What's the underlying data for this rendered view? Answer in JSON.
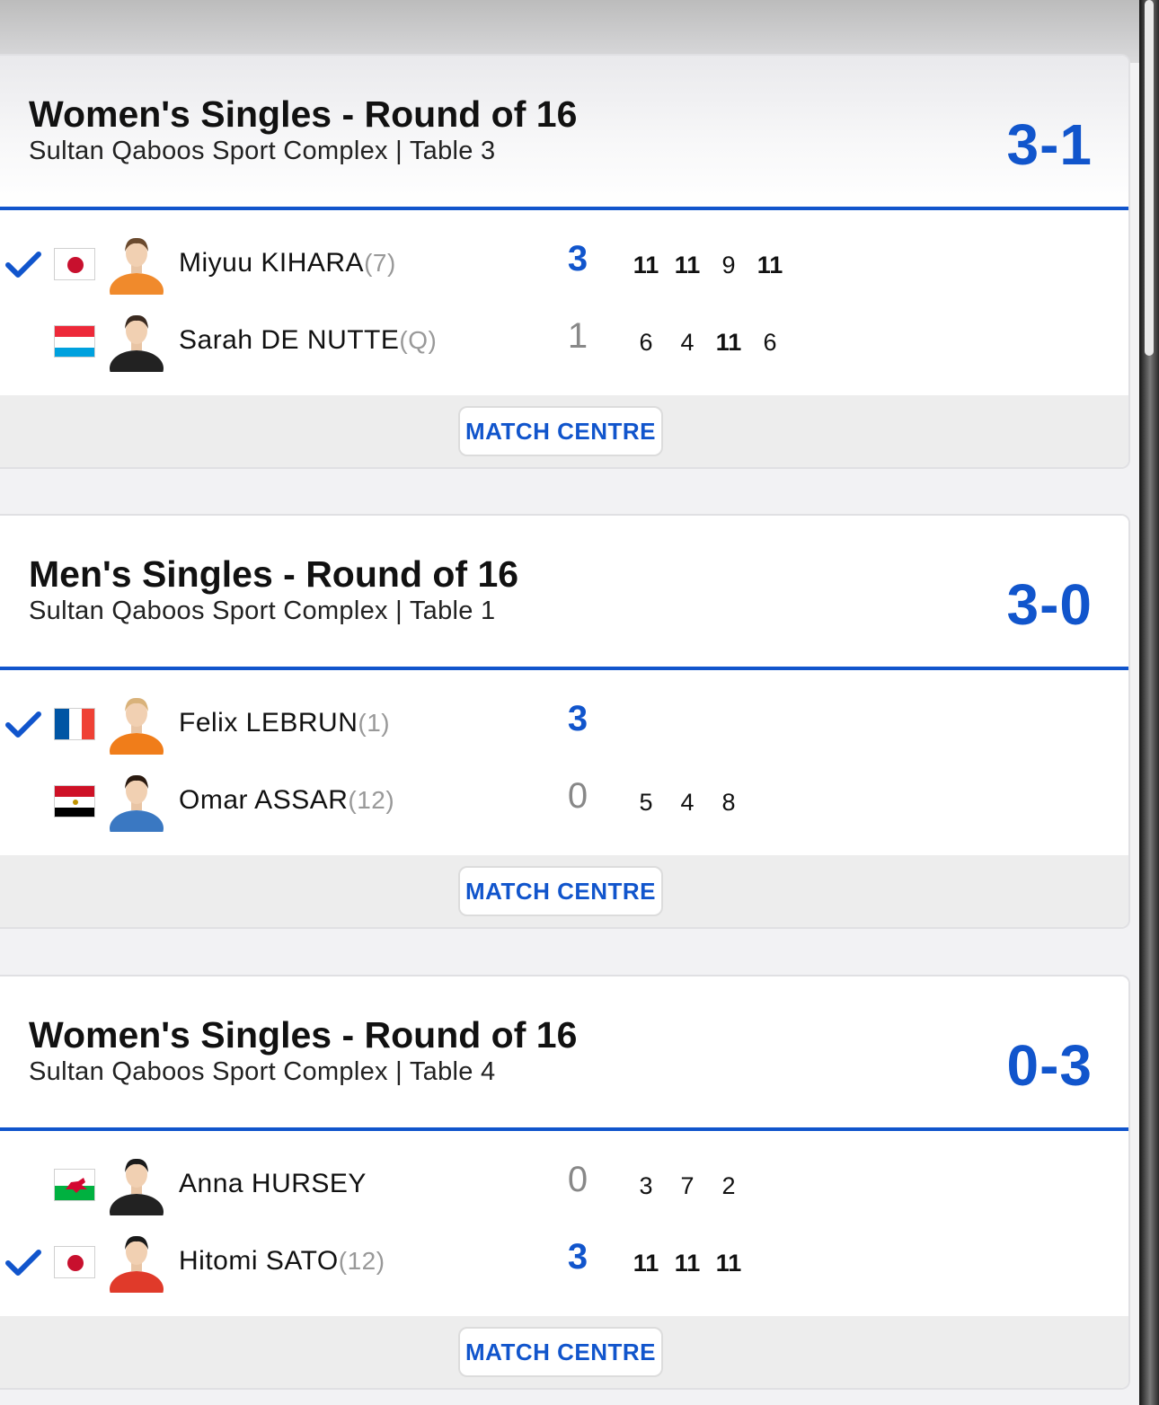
{
  "matches": [
    {
      "event": "Women's Singles - Round of 16",
      "venue": "Sultan Qaboos Sport Complex | Table 3",
      "score": "3-1",
      "players": [
        {
          "name": "Miyuu KIHARA",
          "seed": "(7)",
          "flag": "japan-flag",
          "games": "3",
          "sets": [
            "11",
            "11",
            "9",
            "11"
          ],
          "winner": true
        },
        {
          "name": "Sarah DE NUTTE",
          "seed": "(Q)",
          "flag": "luxembourg-flag",
          "games": "1",
          "sets": [
            "6",
            "4",
            "11",
            "6"
          ],
          "winner": false
        }
      ],
      "button": "MATCH CENTRE"
    },
    {
      "event": "Men's Singles - Round of 16",
      "venue": "Sultan Qaboos Sport Complex | Table 1",
      "score": "3-0",
      "players": [
        {
          "name": "Felix LEBRUN",
          "seed": "(1)",
          "flag": "france-flag",
          "games": "3",
          "sets": [],
          "winner": true
        },
        {
          "name": "Omar ASSAR",
          "seed": "(12)",
          "flag": "egypt-flag",
          "games": "0",
          "sets": [
            "5",
            "4",
            "8"
          ],
          "winner": false
        }
      ],
      "button": "MATCH CENTRE"
    },
    {
      "event": "Women's Singles - Round of 16",
      "venue": "Sultan Qaboos Sport Complex | Table 4",
      "score": "0-3",
      "players": [
        {
          "name": "Anna HURSEY",
          "seed": "",
          "flag": "wales-flag",
          "games": "0",
          "sets": [
            "3",
            "7",
            "2"
          ],
          "winner": false
        },
        {
          "name": "Hitomi SATO",
          "seed": "(12)",
          "flag": "japan-flag",
          "games": "3",
          "sets": [
            "11",
            "11",
            "11"
          ],
          "winner": true
        }
      ],
      "button": "MATCH CENTRE"
    }
  ],
  "colors": {
    "accent": "#1155cc",
    "loser_games": "#888888",
    "seed": "#999999"
  }
}
